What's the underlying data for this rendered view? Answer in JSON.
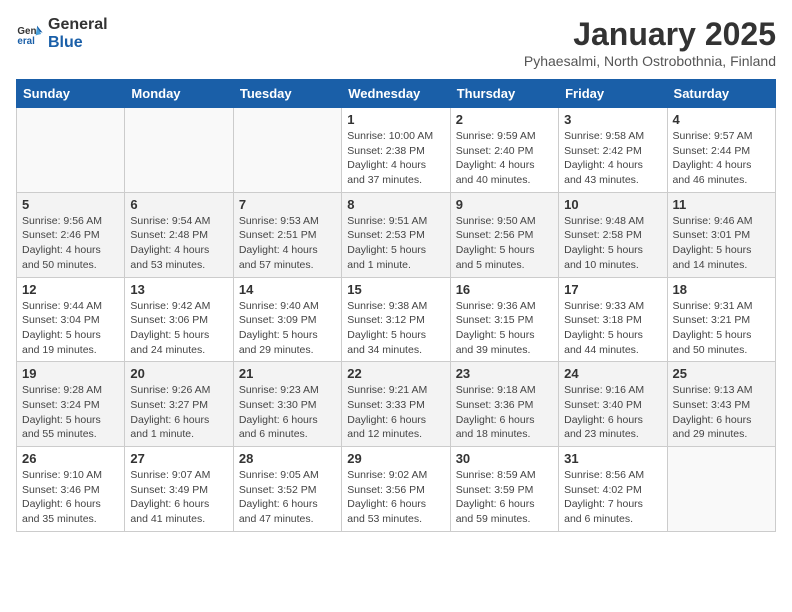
{
  "logo": {
    "line1": "General",
    "line2": "Blue"
  },
  "title": "January 2025",
  "subtitle": "Pyhaesalmi, North Ostrobothnia, Finland",
  "headers": [
    "Sunday",
    "Monday",
    "Tuesday",
    "Wednesday",
    "Thursday",
    "Friday",
    "Saturday"
  ],
  "weeks": [
    [
      {
        "day": "",
        "info": ""
      },
      {
        "day": "",
        "info": ""
      },
      {
        "day": "",
        "info": ""
      },
      {
        "day": "1",
        "info": "Sunrise: 10:00 AM\nSunset: 2:38 PM\nDaylight: 4 hours\nand 37 minutes."
      },
      {
        "day": "2",
        "info": "Sunrise: 9:59 AM\nSunset: 2:40 PM\nDaylight: 4 hours\nand 40 minutes."
      },
      {
        "day": "3",
        "info": "Sunrise: 9:58 AM\nSunset: 2:42 PM\nDaylight: 4 hours\nand 43 minutes."
      },
      {
        "day": "4",
        "info": "Sunrise: 9:57 AM\nSunset: 2:44 PM\nDaylight: 4 hours\nand 46 minutes."
      }
    ],
    [
      {
        "day": "5",
        "info": "Sunrise: 9:56 AM\nSunset: 2:46 PM\nDaylight: 4 hours\nand 50 minutes."
      },
      {
        "day": "6",
        "info": "Sunrise: 9:54 AM\nSunset: 2:48 PM\nDaylight: 4 hours\nand 53 minutes."
      },
      {
        "day": "7",
        "info": "Sunrise: 9:53 AM\nSunset: 2:51 PM\nDaylight: 4 hours\nand 57 minutes."
      },
      {
        "day": "8",
        "info": "Sunrise: 9:51 AM\nSunset: 2:53 PM\nDaylight: 5 hours\nand 1 minute."
      },
      {
        "day": "9",
        "info": "Sunrise: 9:50 AM\nSunset: 2:56 PM\nDaylight: 5 hours\nand 5 minutes."
      },
      {
        "day": "10",
        "info": "Sunrise: 9:48 AM\nSunset: 2:58 PM\nDaylight: 5 hours\nand 10 minutes."
      },
      {
        "day": "11",
        "info": "Sunrise: 9:46 AM\nSunset: 3:01 PM\nDaylight: 5 hours\nand 14 minutes."
      }
    ],
    [
      {
        "day": "12",
        "info": "Sunrise: 9:44 AM\nSunset: 3:04 PM\nDaylight: 5 hours\nand 19 minutes."
      },
      {
        "day": "13",
        "info": "Sunrise: 9:42 AM\nSunset: 3:06 PM\nDaylight: 5 hours\nand 24 minutes."
      },
      {
        "day": "14",
        "info": "Sunrise: 9:40 AM\nSunset: 3:09 PM\nDaylight: 5 hours\nand 29 minutes."
      },
      {
        "day": "15",
        "info": "Sunrise: 9:38 AM\nSunset: 3:12 PM\nDaylight: 5 hours\nand 34 minutes."
      },
      {
        "day": "16",
        "info": "Sunrise: 9:36 AM\nSunset: 3:15 PM\nDaylight: 5 hours\nand 39 minutes."
      },
      {
        "day": "17",
        "info": "Sunrise: 9:33 AM\nSunset: 3:18 PM\nDaylight: 5 hours\nand 44 minutes."
      },
      {
        "day": "18",
        "info": "Sunrise: 9:31 AM\nSunset: 3:21 PM\nDaylight: 5 hours\nand 50 minutes."
      }
    ],
    [
      {
        "day": "19",
        "info": "Sunrise: 9:28 AM\nSunset: 3:24 PM\nDaylight: 5 hours\nand 55 minutes."
      },
      {
        "day": "20",
        "info": "Sunrise: 9:26 AM\nSunset: 3:27 PM\nDaylight: 6 hours\nand 1 minute."
      },
      {
        "day": "21",
        "info": "Sunrise: 9:23 AM\nSunset: 3:30 PM\nDaylight: 6 hours\nand 6 minutes."
      },
      {
        "day": "22",
        "info": "Sunrise: 9:21 AM\nSunset: 3:33 PM\nDaylight: 6 hours\nand 12 minutes."
      },
      {
        "day": "23",
        "info": "Sunrise: 9:18 AM\nSunset: 3:36 PM\nDaylight: 6 hours\nand 18 minutes."
      },
      {
        "day": "24",
        "info": "Sunrise: 9:16 AM\nSunset: 3:40 PM\nDaylight: 6 hours\nand 23 minutes."
      },
      {
        "day": "25",
        "info": "Sunrise: 9:13 AM\nSunset: 3:43 PM\nDaylight: 6 hours\nand 29 minutes."
      }
    ],
    [
      {
        "day": "26",
        "info": "Sunrise: 9:10 AM\nSunset: 3:46 PM\nDaylight: 6 hours\nand 35 minutes."
      },
      {
        "day": "27",
        "info": "Sunrise: 9:07 AM\nSunset: 3:49 PM\nDaylight: 6 hours\nand 41 minutes."
      },
      {
        "day": "28",
        "info": "Sunrise: 9:05 AM\nSunset: 3:52 PM\nDaylight: 6 hours\nand 47 minutes."
      },
      {
        "day": "29",
        "info": "Sunrise: 9:02 AM\nSunset: 3:56 PM\nDaylight: 6 hours\nand 53 minutes."
      },
      {
        "day": "30",
        "info": "Sunrise: 8:59 AM\nSunset: 3:59 PM\nDaylight: 6 hours\nand 59 minutes."
      },
      {
        "day": "31",
        "info": "Sunrise: 8:56 AM\nSunset: 4:02 PM\nDaylight: 7 hours\nand 6 minutes."
      },
      {
        "day": "",
        "info": ""
      }
    ]
  ]
}
